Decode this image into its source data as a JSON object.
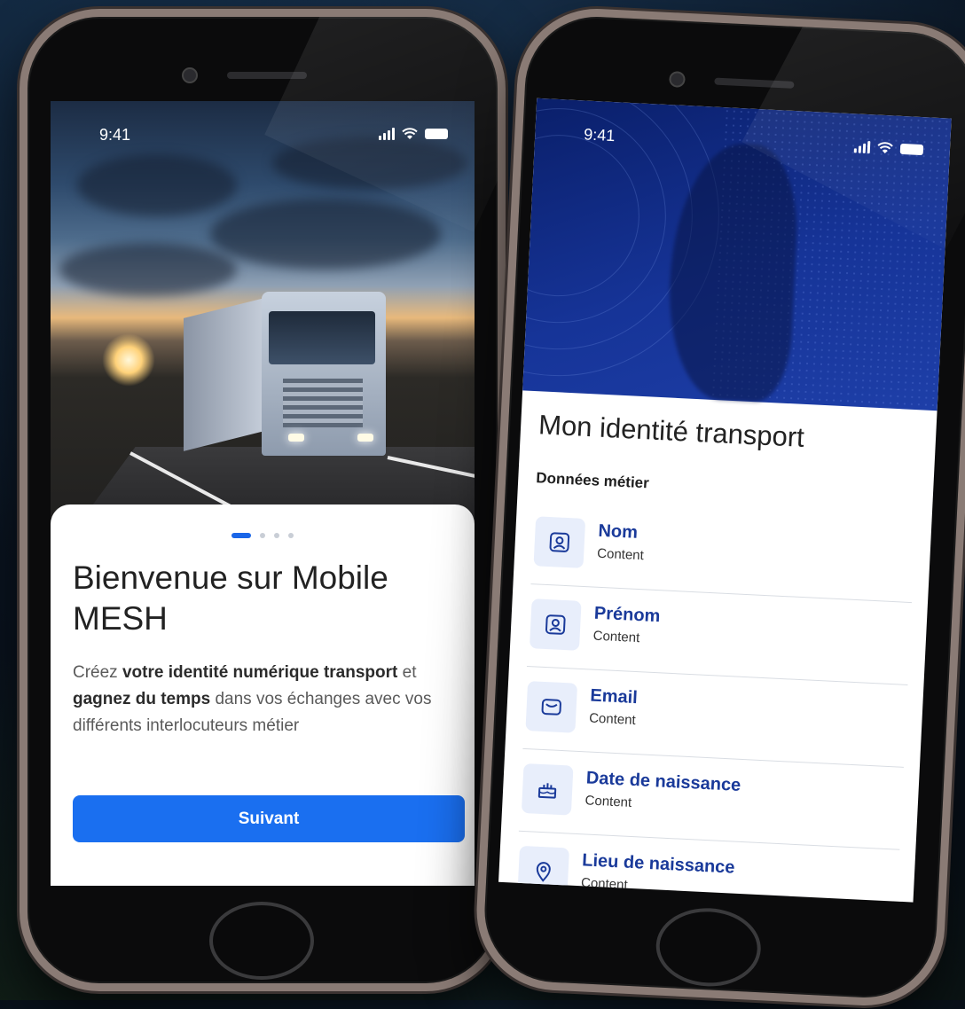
{
  "left_phone": {
    "status": {
      "time": "9:41"
    },
    "pagination": {
      "total": 4,
      "active_index": 0
    },
    "title": "Bienvenue sur Mobile MESH",
    "description": {
      "p1": "Créez ",
      "b1": "votre identité numérique transport",
      "p2": " et ",
      "b2": "gagnez du temps",
      "p3": " dans vos échanges avec vos différents interlocuteurs métier"
    },
    "button_label": "Suivant"
  },
  "right_phone": {
    "status": {
      "time": "9:41"
    },
    "title": "Mon identité transport",
    "section": "Données métier",
    "fields": [
      {
        "label": "Nom",
        "value": "Content",
        "icon": "id-card-icon"
      },
      {
        "label": "Prénom",
        "value": "Content",
        "icon": "id-card-icon"
      },
      {
        "label": "Email",
        "value": "Content",
        "icon": "envelope-icon"
      },
      {
        "label": "Date de naissance",
        "value": "Content",
        "icon": "birthday-cake-icon"
      },
      {
        "label": "Lieu de naissance",
        "value": "Content",
        "icon": "location-pin-icon"
      }
    ]
  },
  "colors": {
    "primary": "#1a6ff0",
    "label_blue": "#1a3a9a",
    "icon_bg": "#e8eefb",
    "hero_blue": "#163498"
  }
}
